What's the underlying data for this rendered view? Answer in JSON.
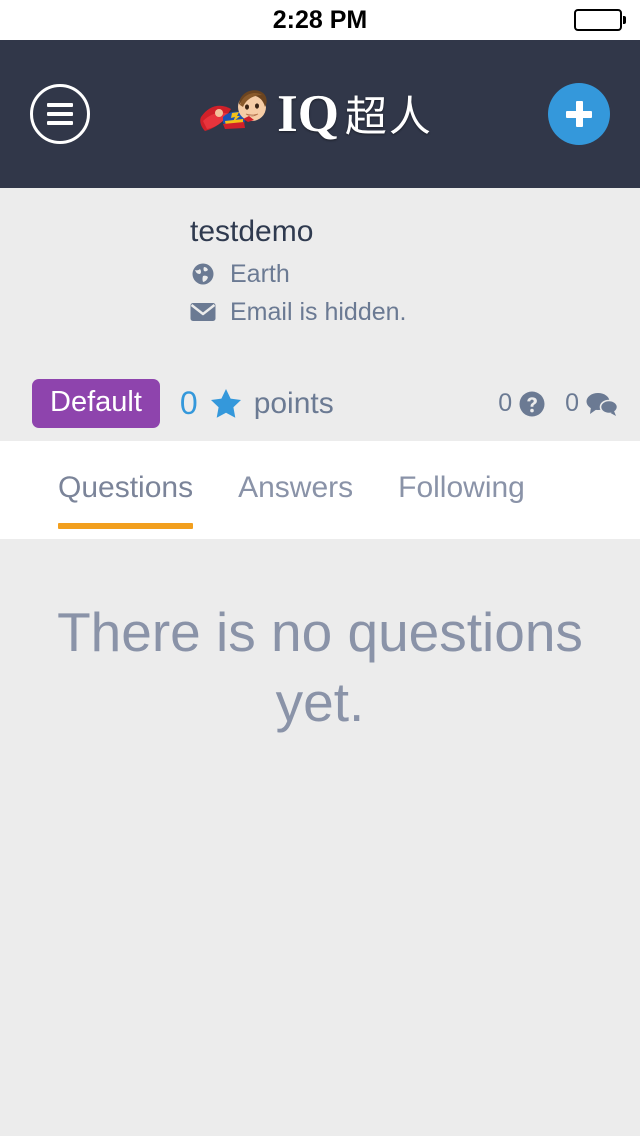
{
  "status_bar": {
    "time": "2:28 PM",
    "battery_icon": "battery-full-icon"
  },
  "header": {
    "menu_icon": "hamburger-menu-icon",
    "logo": {
      "mascot_icon": "flying-superhero-boy-icon",
      "text_latin": "IQ",
      "text_cjk": "超人"
    },
    "add_icon": "plus-icon",
    "background_color": "#313749"
  },
  "profile": {
    "username": "testdemo",
    "location_icon": "globe-icon",
    "location": "Earth",
    "email_icon": "envelope-icon",
    "email": "Email is hidden."
  },
  "stats": {
    "badge_label": "Default",
    "badge_color": "#8e44ad",
    "points_value": "0",
    "star_icon": "star-icon",
    "star_color": "#3498db",
    "points_label": "points",
    "questions_count": "0",
    "questions_icon": "question-circle-icon",
    "answers_count": "0",
    "answers_icon": "comments-icon"
  },
  "tabs": {
    "active_index": 0,
    "active_color": "#f29f1e",
    "items": [
      {
        "label": "Questions"
      },
      {
        "label": "Answers"
      },
      {
        "label": "Following"
      }
    ]
  },
  "content": {
    "empty_message": "There is no questions yet."
  }
}
